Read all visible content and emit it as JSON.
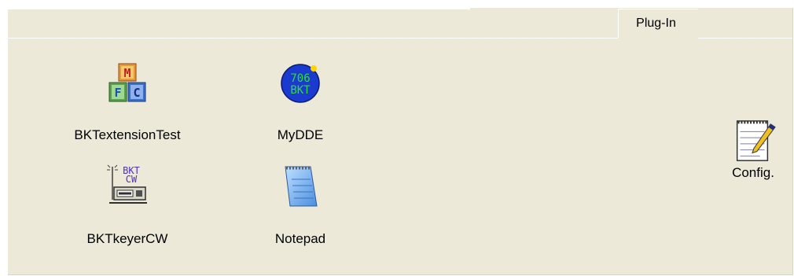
{
  "tabs": [
    {
      "label": "Plug-In",
      "selected": true
    }
  ],
  "plugins": [
    {
      "label": "BKTextensionTest",
      "icon": "alphabet-blocks-icon",
      "blocks": [
        "M",
        "F",
        "C"
      ]
    },
    {
      "label": "MyDDE",
      "icon": "706-bkt-badge-icon",
      "badge_line1": "706",
      "badge_line2": "BKT"
    },
    {
      "label": "BKTkeyerCW",
      "icon": "cw-keyer-radio-icon",
      "icon_line1": "BKT",
      "icon_line2": "CW"
    },
    {
      "label": "Notepad",
      "icon": "notepad-icon"
    }
  ],
  "config": {
    "label": "Config.",
    "icon": "notepad-pen-icon"
  }
}
